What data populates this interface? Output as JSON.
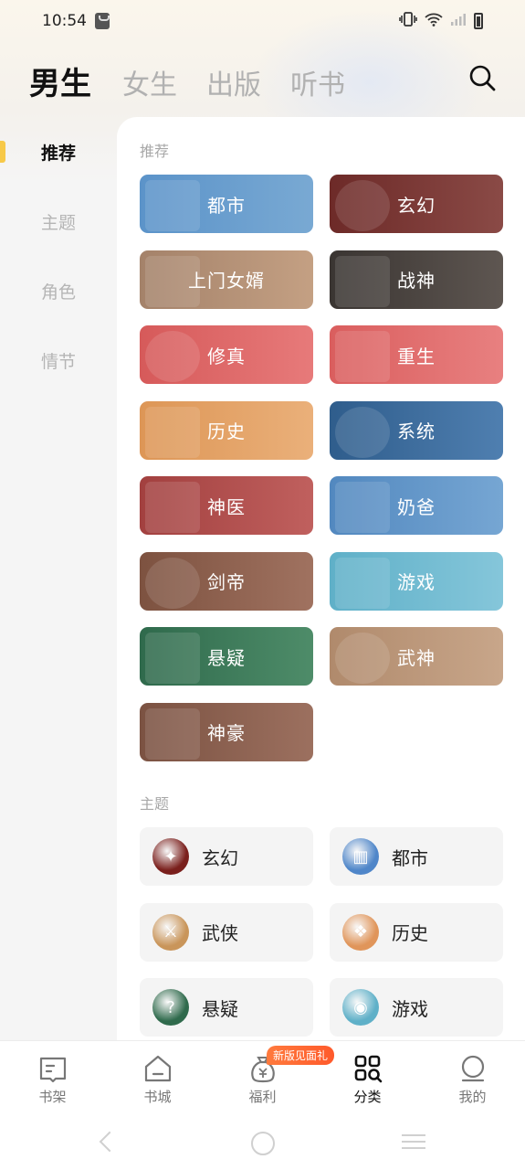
{
  "status": {
    "time": "10:54"
  },
  "tabs": [
    "男生",
    "女生",
    "出版",
    "听书"
  ],
  "sidebar": [
    "推荐",
    "主题",
    "角色",
    "情节"
  ],
  "recommend": {
    "title": "推荐",
    "items": [
      {
        "label": "都市",
        "color1": "#5b93c9",
        "color2": "#79a9d3"
      },
      {
        "label": "玄幻",
        "color1": "#6d2a28",
        "color2": "#8a4a46"
      },
      {
        "label": "上门女婿",
        "color1": "#a4826a",
        "color2": "#c4a083"
      },
      {
        "label": "战神",
        "color1": "#3a3532",
        "color2": "#5e5651"
      },
      {
        "label": "修真",
        "color1": "#d65a5a",
        "color2": "#e77a7a"
      },
      {
        "label": "重生",
        "color1": "#da5e5e",
        "color2": "#e88080"
      },
      {
        "label": "历史",
        "color1": "#dd9656",
        "color2": "#eab07a"
      },
      {
        "label": "系统",
        "color1": "#2f5d8c",
        "color2": "#4f7fb0"
      },
      {
        "label": "神医",
        "color1": "#a2403f",
        "color2": "#c0605e"
      },
      {
        "label": "奶爸",
        "color1": "#5288bf",
        "color2": "#76a6d3"
      },
      {
        "label": "剑帝",
        "color1": "#7d5240",
        "color2": "#a07260"
      },
      {
        "label": "游戏",
        "color1": "#5fb0c8",
        "color2": "#85c6da"
      },
      {
        "label": "悬疑",
        "color1": "#2f6a4c",
        "color2": "#4e8c69"
      },
      {
        "label": "武神",
        "color1": "#b08a6c",
        "color2": "#c8a68a"
      },
      {
        "label": "神豪",
        "color1": "#7b5242",
        "color2": "#9c705f"
      }
    ]
  },
  "themes": {
    "title": "主题",
    "items": [
      {
        "label": "玄幻",
        "icon": "fantasy-icon",
        "color": "#7a1f1c"
      },
      {
        "label": "都市",
        "icon": "city-icon",
        "color": "#4f86c9"
      },
      {
        "label": "武侠",
        "icon": "martial-icon",
        "color": "#c9955a"
      },
      {
        "label": "历史",
        "icon": "history-icon",
        "color": "#e0955a"
      },
      {
        "label": "悬疑",
        "icon": "mystery-icon",
        "color": "#2f6a4c"
      },
      {
        "label": "游戏",
        "icon": "game-icon",
        "color": "#5fb0c8"
      }
    ]
  },
  "bottom_nav": [
    {
      "label": "书架",
      "icon": "bookshelf-icon"
    },
    {
      "label": "书城",
      "icon": "bookstore-icon"
    },
    {
      "label": "福利",
      "icon": "welfare-icon"
    },
    {
      "label": "分类",
      "icon": "category-icon"
    },
    {
      "label": "我的",
      "icon": "profile-icon"
    }
  ],
  "promo_badge": "新版见面礼"
}
